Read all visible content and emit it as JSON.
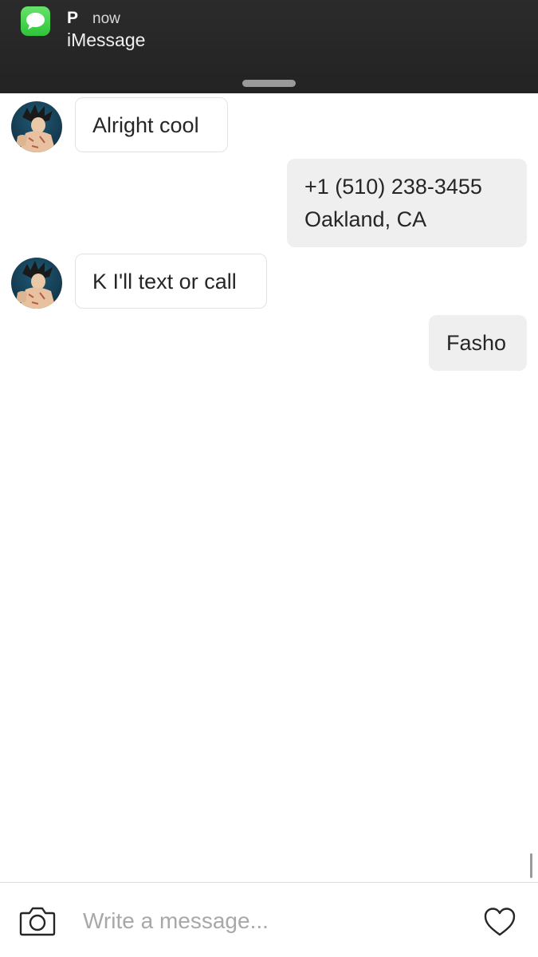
{
  "notification": {
    "sender": "P",
    "time": "now",
    "message": "iMessage",
    "app_icon": "messages-app-icon",
    "accent": "#34c759"
  },
  "messages": [
    {
      "direction": "incoming",
      "lines": [
        "Alright cool"
      ]
    },
    {
      "direction": "outgoing",
      "lines": [
        "+1 (510) 238-3455",
        "Oakland, CA"
      ]
    },
    {
      "direction": "incoming",
      "lines": [
        "K I'll text or call"
      ]
    },
    {
      "direction": "outgoing",
      "lines": [
        "Fasho"
      ]
    }
  ],
  "composer": {
    "placeholder": "Write a message...",
    "value": "",
    "camera_icon": "camera-icon",
    "like_icon": "heart-icon"
  },
  "colors": {
    "banner_bg": "#262626",
    "outgoing_bubble": "#efefef",
    "incoming_border": "#e3e3e3",
    "text": "#262626",
    "placeholder": "#a8a8a8"
  }
}
